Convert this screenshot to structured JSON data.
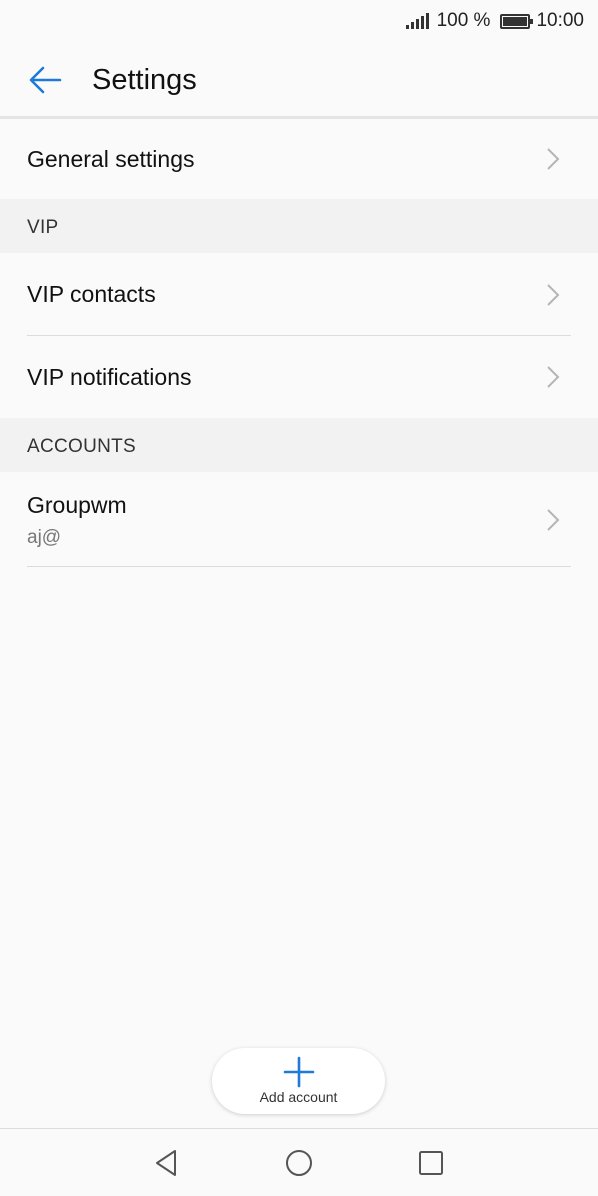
{
  "status_bar": {
    "battery_percent": "100 %",
    "time": "10:00",
    "icons": [
      "signal-icon",
      "battery-icon"
    ]
  },
  "header": {
    "title": "Settings",
    "back_icon": "arrow-left-icon"
  },
  "rows": {
    "general_settings": "General settings",
    "vip_contacts": "VIP contacts",
    "vip_notifications": "VIP notifications"
  },
  "sections": {
    "vip": "VIP",
    "accounts": "ACCOUNTS"
  },
  "account": {
    "name": "Groupwm",
    "email": "aj@"
  },
  "add_account": {
    "label": "Add account",
    "icon": "plus-icon"
  },
  "nav": {
    "icons": [
      "back-triangle-icon",
      "home-circle-icon",
      "recents-square-icon"
    ]
  },
  "colors": {
    "accent": "#1e7ad6",
    "background": "#fafafa",
    "section_bg": "#f2f2f2"
  }
}
